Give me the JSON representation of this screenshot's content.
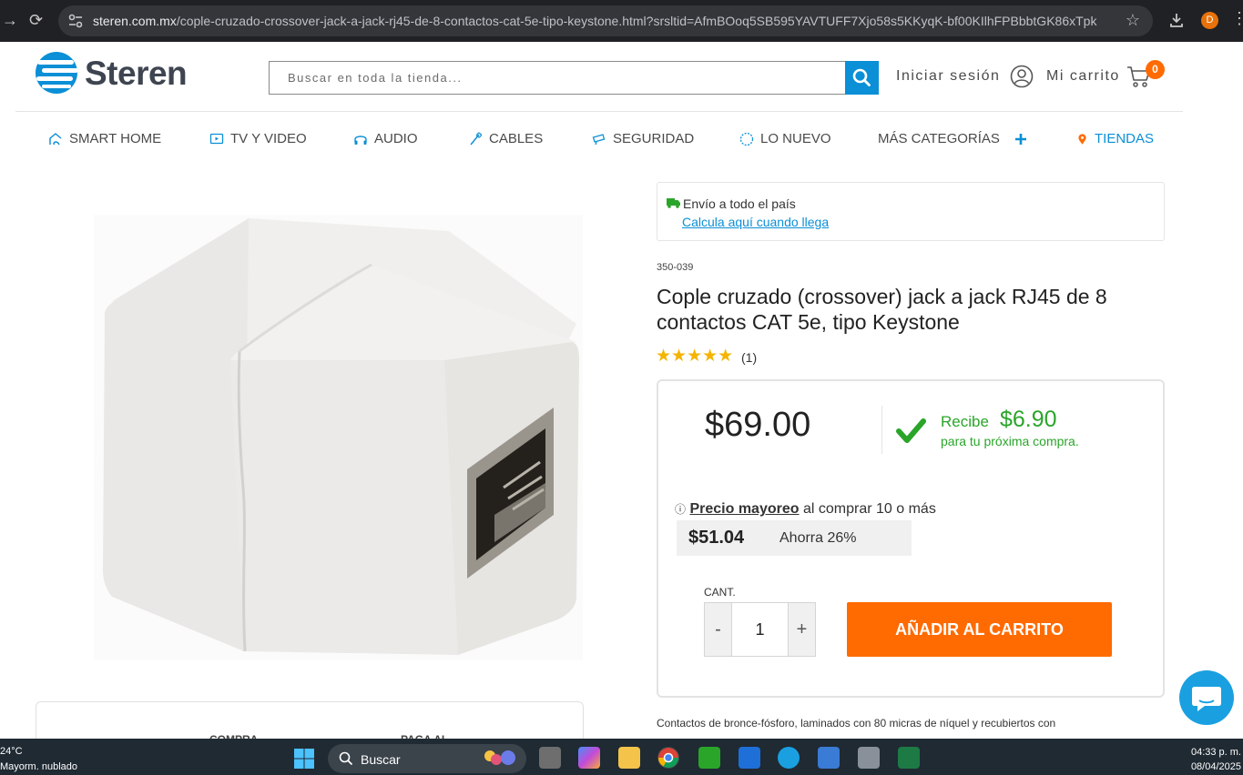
{
  "browser": {
    "url_host": "steren.com.mx",
    "url_path": "/cople-cruzado-crossover-jack-a-jack-rj45-de-8-contactos-cat-5e-tipo-keystone.html?srsltid=AfmBOoq5SB595YAVTUFF7Xjo58s5KKyqK-bf00KIlhFPBbbtGK86xTpk",
    "profile_initial": "D"
  },
  "header": {
    "logo_text": "Steren",
    "search_placeholder": "Buscar en toda la tienda...",
    "login_label": "Iniciar sesión",
    "cart_label": "Mi carrito",
    "cart_count": "0"
  },
  "nav": {
    "items": [
      {
        "label": "SMART HOME",
        "icon": "smart-home-icon"
      },
      {
        "label": "TV Y VIDEO",
        "icon": "tv-icon"
      },
      {
        "label": "AUDIO",
        "icon": "headphones-icon"
      },
      {
        "label": "CABLES",
        "icon": "cable-icon"
      },
      {
        "label": "SEGURIDAD",
        "icon": "camera-icon"
      },
      {
        "label": "LO NUEVO",
        "icon": "new-icon"
      },
      {
        "label": "MÁS CATEGORÍAS",
        "icon": "plus-icon"
      },
      {
        "label": "TIENDAS",
        "icon": "location-pin-icon"
      }
    ]
  },
  "shipping": {
    "title": "Envío a todo el país",
    "link": "Calcula aquí cuando llega"
  },
  "product": {
    "sku": "350-039",
    "title": "Cople cruzado (crossover) jack a jack RJ45 de 8 contactos CAT 5e, tipo Keystone",
    "rating": 5,
    "stars": "★★★★★",
    "reviews": "(1)",
    "price": "$69.00",
    "reward_label": "Recibe",
    "reward_amount": "$6.90",
    "reward_sub": "para tu próxima compra.",
    "wholesale_icon": "ⓘ",
    "wholesale_label": "Precio mayoreo",
    "wholesale_text": " al comprar 10 o más",
    "wholesale_price": "$51.04",
    "wholesale_savings": "Ahorra 26%",
    "qty_label": "CANT.",
    "qty_value": "1",
    "minus": "-",
    "plus": "+",
    "add_to_cart": "AÑADIR AL CARRITO",
    "description": "Contactos de bronce-fósforo, laminados con 80 micras de níquel y recubiertos con"
  },
  "info_strip": {
    "item1": "COMPRA",
    "item2": "PAGA AL"
  },
  "taskbar": {
    "temp": "24°C",
    "weather": "Mayorm. nublado",
    "search_label": "Buscar",
    "time": "04:33 p. m.",
    "date": "08/04/2025"
  },
  "colors": {
    "accent_blue": "#0b8fd6",
    "orange": "#ff6b00",
    "green": "#2aa52a",
    "star": "#f4b400"
  }
}
